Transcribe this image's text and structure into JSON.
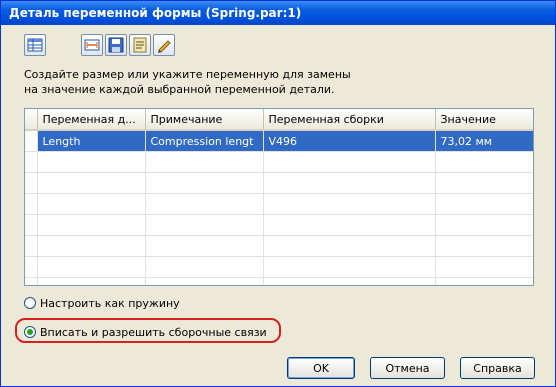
{
  "window": {
    "title": "Деталь переменной формы (Spring.par:1)"
  },
  "toolbar": {
    "buttons": [
      {
        "icon": "grid-select-icon"
      },
      {
        "icon": "insert-dimension-icon"
      },
      {
        "icon": "save-icon"
      },
      {
        "icon": "variable-table-icon"
      },
      {
        "icon": "edit-pencil-icon"
      }
    ]
  },
  "instructions": {
    "line1": "Создайте размер или укажите переменную для замены",
    "line2": "на значение каждой выбранной переменной детали."
  },
  "grid": {
    "columns": [
      "Переменная д...",
      "Примечание",
      "Переменная сборки",
      "Значение"
    ],
    "rows": [
      {
        "part_variable": "Length",
        "note": "Compression lengt",
        "assembly_variable": "V496",
        "value": "73,02 мм",
        "selected": true
      }
    ],
    "empty_rows": 7
  },
  "options": {
    "spring_label": "Настроить как пружину",
    "fit_label": "Вписать и разрешить сборочные связи",
    "selected": "fit"
  },
  "buttons": {
    "ok": "OK",
    "cancel": "Отмена",
    "help": "Справка"
  },
  "colors": {
    "selection": "#316ac5",
    "highlight_frame": "#d91f1f",
    "titlebar": "#0054e3"
  }
}
